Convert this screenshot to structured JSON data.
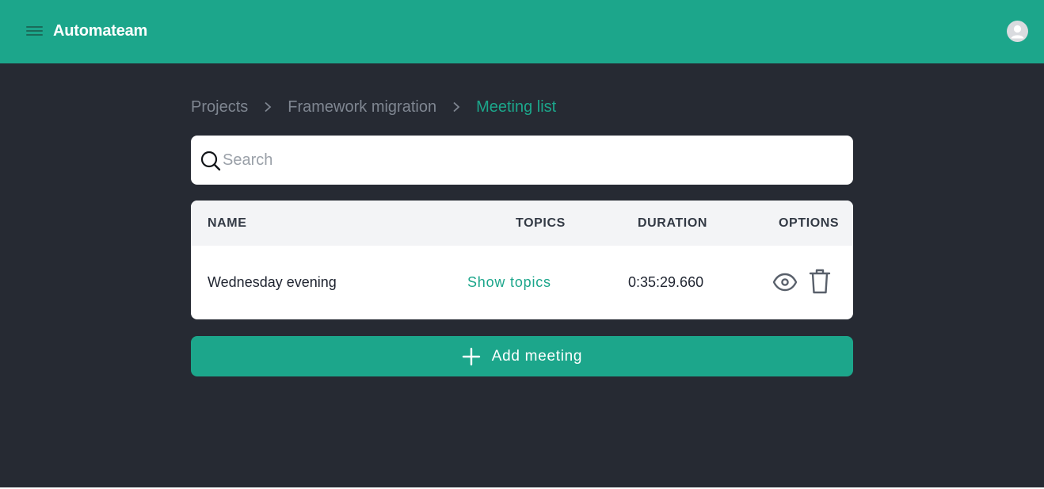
{
  "header": {
    "title": "Automateam",
    "brand_color": "#1ca68b",
    "menu_icon": "hamburger-icon",
    "avatar_icon": "user-avatar-icon"
  },
  "breadcrumb": {
    "items": [
      {
        "label": "Projects"
      },
      {
        "label": "Framework migration"
      },
      {
        "label": "Meeting list"
      }
    ]
  },
  "search": {
    "placeholder": "Search",
    "value": "",
    "icon": "search-icon"
  },
  "table": {
    "columns": {
      "name": "NAME",
      "topics": "TOPICS",
      "duration": "DURATION",
      "options": "OPTIONS"
    },
    "rows": [
      {
        "name": "Wednesday evening",
        "topics_link": "Show topics",
        "duration": "0:35:29.660",
        "view_icon": "eye-icon",
        "delete_icon": "trash-icon"
      }
    ]
  },
  "add_button": {
    "label": "Add meeting",
    "icon": "plus-icon"
  },
  "colors": {
    "background": "#262a33",
    "accent": "#1ca68b",
    "muted_text": "#7f8691"
  }
}
